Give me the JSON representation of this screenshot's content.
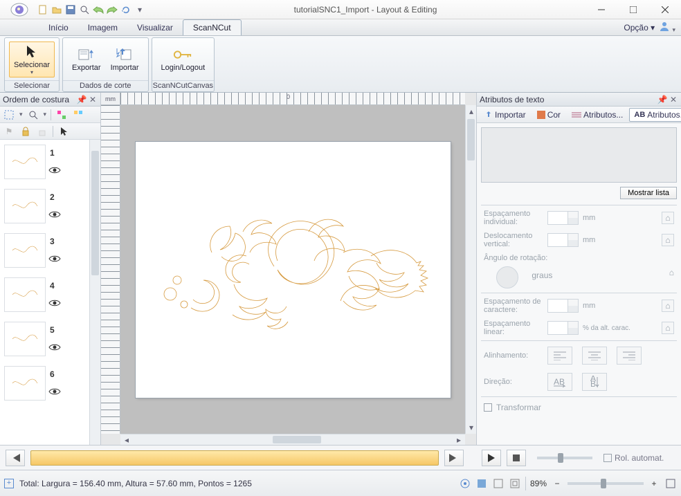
{
  "app": {
    "title": "tutorialSNC1_Import - Layout & Editing",
    "option_label": "Opção"
  },
  "menubar": {
    "tabs": [
      "Início",
      "Imagem",
      "Visualizar",
      "ScanNCut"
    ],
    "active_index": 3
  },
  "ribbon": {
    "groups": [
      {
        "label": "Selecionar",
        "buttons": [
          {
            "label": "Selecionar",
            "icon": "cursor",
            "selected": true
          }
        ]
      },
      {
        "label": "Dados de corte",
        "buttons": [
          {
            "label": "Exportar",
            "icon": "export"
          },
          {
            "label": "Importar",
            "icon": "import"
          }
        ]
      },
      {
        "label": "ScanNCutCanvas",
        "buttons": [
          {
            "label": "Login/Logout",
            "icon": "key"
          }
        ]
      }
    ]
  },
  "left_panel": {
    "title": "Ordem de costura",
    "items": [
      {
        "n": "1"
      },
      {
        "n": "2"
      },
      {
        "n": "3"
      },
      {
        "n": "4"
      },
      {
        "n": "5"
      },
      {
        "n": "6"
      }
    ]
  },
  "ruler_unit": "mm",
  "ruler_zero": "0",
  "right_panel": {
    "title": "Atributos de texto",
    "tabs": [
      {
        "icon": "import",
        "label": "Importar"
      },
      {
        "icon": "palette",
        "label": "Cor"
      },
      {
        "icon": "stitches",
        "label": "Atributos..."
      },
      {
        "icon": "ab",
        "label": "Atributos...",
        "active": true
      }
    ],
    "show_list_btn": "Mostrar lista",
    "fields": {
      "individual_spacing": {
        "label": "Espaçamento individual:",
        "unit": "mm"
      },
      "vertical_offset": {
        "label": "Deslocamento vertical:",
        "unit": "mm"
      },
      "rotation_angle": {
        "label": "Ângulo de rotação:",
        "unit": "graus"
      },
      "char_spacing": {
        "label": "Espaçamento de caractere:",
        "unit": "mm"
      },
      "linear_spacing": {
        "label": "Espaçamento linear:",
        "unit": "% da alt. carac."
      },
      "alignment": {
        "label": "Alinhamento:"
      },
      "direction": {
        "label": "Direção:"
      },
      "transform": {
        "label": "Transformar"
      }
    }
  },
  "playbar": {
    "auto_scroll_label": "Rol. automat."
  },
  "status": {
    "text": "Total: Largura = 156.40 mm, Altura = 57.60 mm, Pontos = 1265",
    "zoom": "89%"
  }
}
